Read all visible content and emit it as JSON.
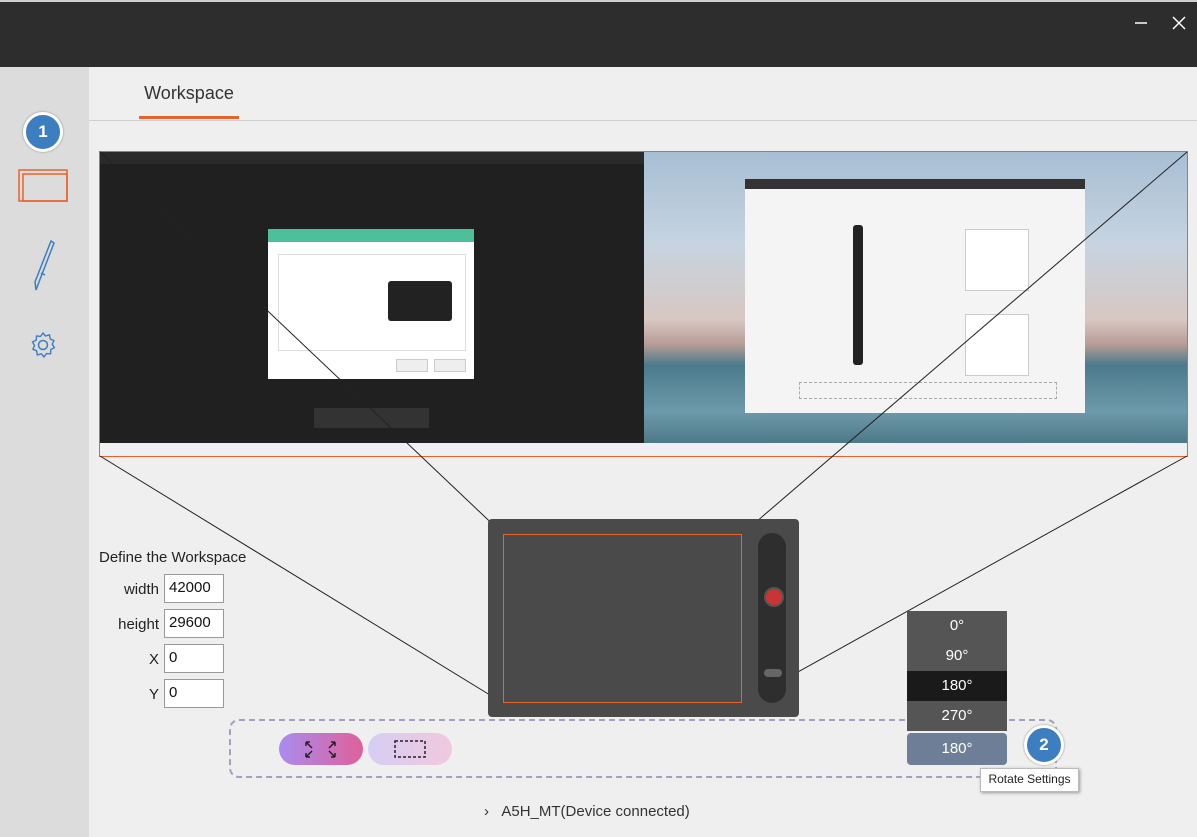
{
  "window": {
    "minimize_icon": "minimize-icon",
    "close_icon": "close-icon"
  },
  "sidebar": {
    "items": [
      {
        "name": "workspace",
        "icon": "workspace-icon",
        "badge": "1"
      },
      {
        "name": "pen",
        "icon": "pen-icon"
      },
      {
        "name": "settings",
        "icon": "gear-icon"
      }
    ]
  },
  "tabs": [
    {
      "label": "Workspace",
      "active": true
    }
  ],
  "define": {
    "title": "Define the Workspace",
    "fields": [
      {
        "label": "width",
        "value": "42000"
      },
      {
        "label": "height",
        "value": "29600"
      },
      {
        "label": "X",
        "value": "0"
      },
      {
        "label": "Y",
        "value": "0"
      }
    ]
  },
  "rotate": {
    "options": [
      "0°",
      "90°",
      "180°",
      "270°"
    ],
    "selected": "180°",
    "badge": "2",
    "tooltip": "Rotate Settings"
  },
  "status": {
    "text": "A5H_MT(Device connected)"
  },
  "colors": {
    "accent": "#e8622c",
    "badge": "#3d7ec0",
    "titlebar": "#2d2d2d"
  }
}
